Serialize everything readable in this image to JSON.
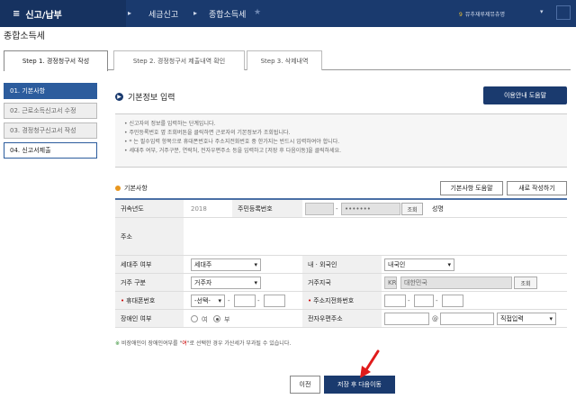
{
  "topbar": {
    "menu_icon": "≡",
    "menu_title": "신고/납부",
    "arrow": "▸",
    "crumb1": "세금신고",
    "crumb2": "종합소득세",
    "star": "★",
    "user_dot": "9",
    "user_text": "뮤추재루제뮤츄명",
    "caret": "▾"
  },
  "page_title": "종합소득세",
  "tabs": [
    {
      "label": "Step 1. 경정청구서 작성"
    },
    {
      "label": "Step 2. 경정청구서 제출내역 확인"
    },
    {
      "label": "Step 3. 삭제내역"
    }
  ],
  "sidenav": [
    {
      "label": "01. 기본사항"
    },
    {
      "label": "02. 근로소득신고서 수정"
    },
    {
      "label": "03. 경정청구신고서 작성"
    },
    {
      "label": "04. 신고서제출"
    }
  ],
  "section_title": "기본정보 입력",
  "help_button": "이용안내 도움말",
  "notices": [
    "신고자의 정보를 입력하는 단계입니다.",
    "주민등록번호 옆 조회버튼을 클릭하면 근로자의 기본정보가 조회됩니다.",
    "* 는 필수입력 항목으로 휴대폰번호나 주소지전화번호 중 한가지는 반드시 입력하여야 합니다.",
    "세대주 여부, 거주구분, 연락처, 전자우편주소 등을 입력하고 [저장 후 다음이동]을 클릭하세요."
  ],
  "sub_title": "기본사항",
  "btn_basic_help": "기본사항 도움말",
  "btn_rewrite": "새로 작성하기",
  "form": {
    "year_label": "귀속년도",
    "year_value": "2018",
    "ssn_label": "주민등록번호",
    "ssn_dash": "-",
    "ssn_back": "•••••••",
    "lookup": "조회",
    "name_label": "성명",
    "addr_label": "주소",
    "hoh_label": "세대주 여부",
    "hoh_value": "세대주",
    "nat_label": "내 · 외국인",
    "nat_value": "내국인",
    "res_type_label": "거주 구분",
    "res_type_value": "거주자",
    "res_country_label": "거주지국",
    "res_country_code": "KR",
    "res_country_name": "대한민국",
    "res_country_lookup": "조회",
    "mobile_label": "휴대폰번호",
    "mobile_select": "-선택-",
    "home_tel_label": "주소지전화번호",
    "dash": "-",
    "disabled_label": "장애인 여부",
    "radio_yes": "여",
    "radio_no": "부",
    "email_label": "전자우편주소",
    "email_at": "@",
    "email_domain": "직접입력"
  },
  "footnote_mark": "※",
  "footnote_pre": "비장애인이 장애인여부를 \"",
  "footnote_hl": "여",
  "footnote_post": "\"로 선택한 경우 가산세가 부과될 수 있습니다.",
  "prev_button": "이전",
  "next_button": "저장 후 다음이동",
  "colors": {
    "navy": "#1a3a6e",
    "accent": "#2c5c9d",
    "pointer": "#e01b1b"
  }
}
